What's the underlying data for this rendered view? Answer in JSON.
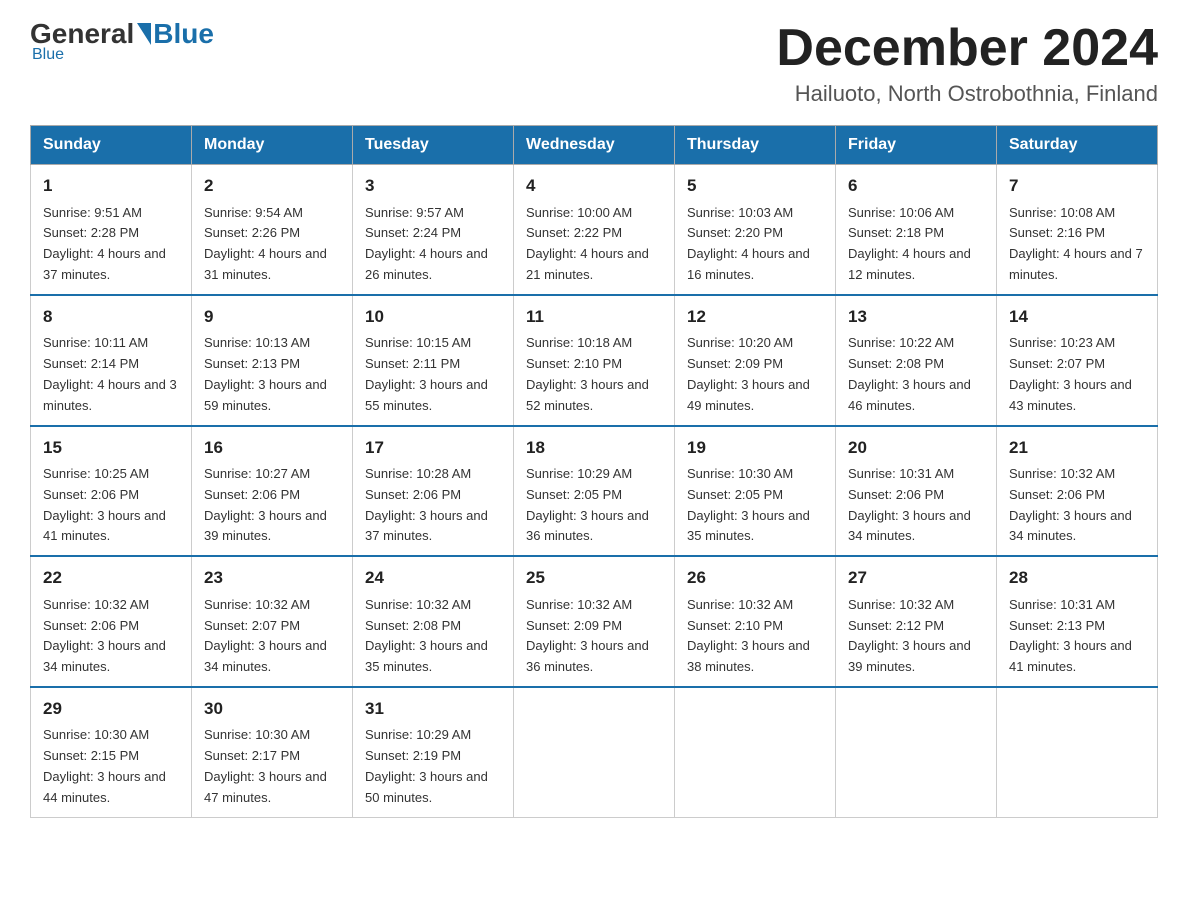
{
  "logo": {
    "general": "General",
    "blue": "Blue",
    "underline": "Blue"
  },
  "title": {
    "month": "December 2024",
    "location": "Hailuoto, North Ostrobothnia, Finland"
  },
  "days_of_week": [
    "Sunday",
    "Monday",
    "Tuesday",
    "Wednesday",
    "Thursday",
    "Friday",
    "Saturday"
  ],
  "weeks": [
    [
      {
        "day": "1",
        "sunrise": "9:51 AM",
        "sunset": "2:28 PM",
        "daylight": "4 hours and 37 minutes."
      },
      {
        "day": "2",
        "sunrise": "9:54 AM",
        "sunset": "2:26 PM",
        "daylight": "4 hours and 31 minutes."
      },
      {
        "day": "3",
        "sunrise": "9:57 AM",
        "sunset": "2:24 PM",
        "daylight": "4 hours and 26 minutes."
      },
      {
        "day": "4",
        "sunrise": "10:00 AM",
        "sunset": "2:22 PM",
        "daylight": "4 hours and 21 minutes."
      },
      {
        "day": "5",
        "sunrise": "10:03 AM",
        "sunset": "2:20 PM",
        "daylight": "4 hours and 16 minutes."
      },
      {
        "day": "6",
        "sunrise": "10:06 AM",
        "sunset": "2:18 PM",
        "daylight": "4 hours and 12 minutes."
      },
      {
        "day": "7",
        "sunrise": "10:08 AM",
        "sunset": "2:16 PM",
        "daylight": "4 hours and 7 minutes."
      }
    ],
    [
      {
        "day": "8",
        "sunrise": "10:11 AM",
        "sunset": "2:14 PM",
        "daylight": "4 hours and 3 minutes."
      },
      {
        "day": "9",
        "sunrise": "10:13 AM",
        "sunset": "2:13 PM",
        "daylight": "3 hours and 59 minutes."
      },
      {
        "day": "10",
        "sunrise": "10:15 AM",
        "sunset": "2:11 PM",
        "daylight": "3 hours and 55 minutes."
      },
      {
        "day": "11",
        "sunrise": "10:18 AM",
        "sunset": "2:10 PM",
        "daylight": "3 hours and 52 minutes."
      },
      {
        "day": "12",
        "sunrise": "10:20 AM",
        "sunset": "2:09 PM",
        "daylight": "3 hours and 49 minutes."
      },
      {
        "day": "13",
        "sunrise": "10:22 AM",
        "sunset": "2:08 PM",
        "daylight": "3 hours and 46 minutes."
      },
      {
        "day": "14",
        "sunrise": "10:23 AM",
        "sunset": "2:07 PM",
        "daylight": "3 hours and 43 minutes."
      }
    ],
    [
      {
        "day": "15",
        "sunrise": "10:25 AM",
        "sunset": "2:06 PM",
        "daylight": "3 hours and 41 minutes."
      },
      {
        "day": "16",
        "sunrise": "10:27 AM",
        "sunset": "2:06 PM",
        "daylight": "3 hours and 39 minutes."
      },
      {
        "day": "17",
        "sunrise": "10:28 AM",
        "sunset": "2:06 PM",
        "daylight": "3 hours and 37 minutes."
      },
      {
        "day": "18",
        "sunrise": "10:29 AM",
        "sunset": "2:05 PM",
        "daylight": "3 hours and 36 minutes."
      },
      {
        "day": "19",
        "sunrise": "10:30 AM",
        "sunset": "2:05 PM",
        "daylight": "3 hours and 35 minutes."
      },
      {
        "day": "20",
        "sunrise": "10:31 AM",
        "sunset": "2:06 PM",
        "daylight": "3 hours and 34 minutes."
      },
      {
        "day": "21",
        "sunrise": "10:32 AM",
        "sunset": "2:06 PM",
        "daylight": "3 hours and 34 minutes."
      }
    ],
    [
      {
        "day": "22",
        "sunrise": "10:32 AM",
        "sunset": "2:06 PM",
        "daylight": "3 hours and 34 minutes."
      },
      {
        "day": "23",
        "sunrise": "10:32 AM",
        "sunset": "2:07 PM",
        "daylight": "3 hours and 34 minutes."
      },
      {
        "day": "24",
        "sunrise": "10:32 AM",
        "sunset": "2:08 PM",
        "daylight": "3 hours and 35 minutes."
      },
      {
        "day": "25",
        "sunrise": "10:32 AM",
        "sunset": "2:09 PM",
        "daylight": "3 hours and 36 minutes."
      },
      {
        "day": "26",
        "sunrise": "10:32 AM",
        "sunset": "2:10 PM",
        "daylight": "3 hours and 38 minutes."
      },
      {
        "day": "27",
        "sunrise": "10:32 AM",
        "sunset": "2:12 PM",
        "daylight": "3 hours and 39 minutes."
      },
      {
        "day": "28",
        "sunrise": "10:31 AM",
        "sunset": "2:13 PM",
        "daylight": "3 hours and 41 minutes."
      }
    ],
    [
      {
        "day": "29",
        "sunrise": "10:30 AM",
        "sunset": "2:15 PM",
        "daylight": "3 hours and 44 minutes."
      },
      {
        "day": "30",
        "sunrise": "10:30 AM",
        "sunset": "2:17 PM",
        "daylight": "3 hours and 47 minutes."
      },
      {
        "day": "31",
        "sunrise": "10:29 AM",
        "sunset": "2:19 PM",
        "daylight": "3 hours and 50 minutes."
      },
      null,
      null,
      null,
      null
    ]
  ]
}
